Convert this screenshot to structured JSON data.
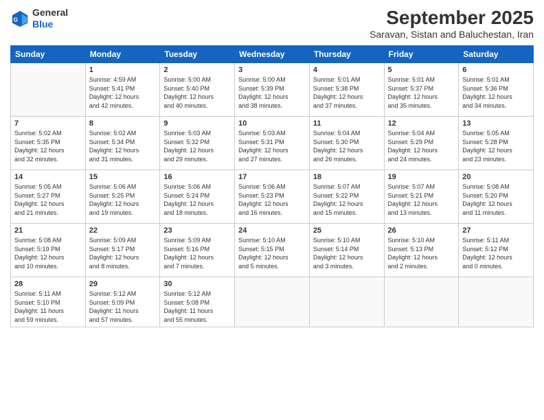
{
  "header": {
    "logo_line1": "General",
    "logo_line2": "Blue",
    "month": "September 2025",
    "location": "Saravan, Sistan and Baluchestan, Iran"
  },
  "weekdays": [
    "Sunday",
    "Monday",
    "Tuesday",
    "Wednesday",
    "Thursday",
    "Friday",
    "Saturday"
  ],
  "weeks": [
    [
      {
        "day": "",
        "info": ""
      },
      {
        "day": "1",
        "info": "Sunrise: 4:59 AM\nSunset: 5:41 PM\nDaylight: 12 hours\nand 42 minutes."
      },
      {
        "day": "2",
        "info": "Sunrise: 5:00 AM\nSunset: 5:40 PM\nDaylight: 12 hours\nand 40 minutes."
      },
      {
        "day": "3",
        "info": "Sunrise: 5:00 AM\nSunset: 5:39 PM\nDaylight: 12 hours\nand 38 minutes."
      },
      {
        "day": "4",
        "info": "Sunrise: 5:01 AM\nSunset: 5:38 PM\nDaylight: 12 hours\nand 37 minutes."
      },
      {
        "day": "5",
        "info": "Sunrise: 5:01 AM\nSunset: 5:37 PM\nDaylight: 12 hours\nand 35 minutes."
      },
      {
        "day": "6",
        "info": "Sunrise: 5:01 AM\nSunset: 5:36 PM\nDaylight: 12 hours\nand 34 minutes."
      }
    ],
    [
      {
        "day": "7",
        "info": "Sunrise: 5:02 AM\nSunset: 5:35 PM\nDaylight: 12 hours\nand 32 minutes."
      },
      {
        "day": "8",
        "info": "Sunrise: 5:02 AM\nSunset: 5:34 PM\nDaylight: 12 hours\nand 31 minutes."
      },
      {
        "day": "9",
        "info": "Sunrise: 5:03 AM\nSunset: 5:32 PM\nDaylight: 12 hours\nand 29 minutes."
      },
      {
        "day": "10",
        "info": "Sunrise: 5:03 AM\nSunset: 5:31 PM\nDaylight: 12 hours\nand 27 minutes."
      },
      {
        "day": "11",
        "info": "Sunrise: 5:04 AM\nSunset: 5:30 PM\nDaylight: 12 hours\nand 26 minutes."
      },
      {
        "day": "12",
        "info": "Sunrise: 5:04 AM\nSunset: 5:29 PM\nDaylight: 12 hours\nand 24 minutes."
      },
      {
        "day": "13",
        "info": "Sunrise: 5:05 AM\nSunset: 5:28 PM\nDaylight: 12 hours\nand 23 minutes."
      }
    ],
    [
      {
        "day": "14",
        "info": "Sunrise: 5:05 AM\nSunset: 5:27 PM\nDaylight: 12 hours\nand 21 minutes."
      },
      {
        "day": "15",
        "info": "Sunrise: 5:06 AM\nSunset: 5:25 PM\nDaylight: 12 hours\nand 19 minutes."
      },
      {
        "day": "16",
        "info": "Sunrise: 5:06 AM\nSunset: 5:24 PM\nDaylight: 12 hours\nand 18 minutes."
      },
      {
        "day": "17",
        "info": "Sunrise: 5:06 AM\nSunset: 5:23 PM\nDaylight: 12 hours\nand 16 minutes."
      },
      {
        "day": "18",
        "info": "Sunrise: 5:07 AM\nSunset: 5:22 PM\nDaylight: 12 hours\nand 15 minutes."
      },
      {
        "day": "19",
        "info": "Sunrise: 5:07 AM\nSunset: 5:21 PM\nDaylight: 12 hours\nand 13 minutes."
      },
      {
        "day": "20",
        "info": "Sunrise: 5:08 AM\nSunset: 5:20 PM\nDaylight: 12 hours\nand 11 minutes."
      }
    ],
    [
      {
        "day": "21",
        "info": "Sunrise: 5:08 AM\nSunset: 5:19 PM\nDaylight: 12 hours\nand 10 minutes."
      },
      {
        "day": "22",
        "info": "Sunrise: 5:09 AM\nSunset: 5:17 PM\nDaylight: 12 hours\nand 8 minutes."
      },
      {
        "day": "23",
        "info": "Sunrise: 5:09 AM\nSunset: 5:16 PM\nDaylight: 12 hours\nand 7 minutes."
      },
      {
        "day": "24",
        "info": "Sunrise: 5:10 AM\nSunset: 5:15 PM\nDaylight: 12 hours\nand 5 minutes."
      },
      {
        "day": "25",
        "info": "Sunrise: 5:10 AM\nSunset: 5:14 PM\nDaylight: 12 hours\nand 3 minutes."
      },
      {
        "day": "26",
        "info": "Sunrise: 5:10 AM\nSunset: 5:13 PM\nDaylight: 12 hours\nand 2 minutes."
      },
      {
        "day": "27",
        "info": "Sunrise: 5:11 AM\nSunset: 5:12 PM\nDaylight: 12 hours\nand 0 minutes."
      }
    ],
    [
      {
        "day": "28",
        "info": "Sunrise: 5:11 AM\nSunset: 5:10 PM\nDaylight: 11 hours\nand 59 minutes."
      },
      {
        "day": "29",
        "info": "Sunrise: 5:12 AM\nSunset: 5:09 PM\nDaylight: 11 hours\nand 57 minutes."
      },
      {
        "day": "30",
        "info": "Sunrise: 5:12 AM\nSunset: 5:08 PM\nDaylight: 11 hours\nand 55 minutes."
      },
      {
        "day": "",
        "info": ""
      },
      {
        "day": "",
        "info": ""
      },
      {
        "day": "",
        "info": ""
      },
      {
        "day": "",
        "info": ""
      }
    ]
  ]
}
